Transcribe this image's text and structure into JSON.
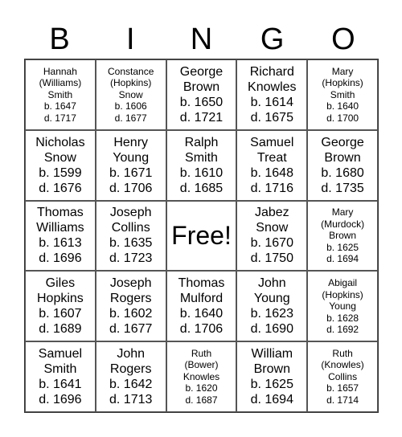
{
  "header": {
    "letters": [
      "B",
      "I",
      "N",
      "G",
      "O"
    ]
  },
  "cells": [
    {
      "text": "Hannah\n(Williams)\nSmith\nb. 1647\nd. 1717",
      "size": "sm"
    },
    {
      "text": "Constance\n(Hopkins)\nSnow\nb. 1606\nd. 1677",
      "size": "sm"
    },
    {
      "text": "George\nBrown\nb. 1650\nd. 1721",
      "size": "lg"
    },
    {
      "text": "Richard\nKnowles\nb. 1614\nd. 1675",
      "size": "lg"
    },
    {
      "text": "Mary\n(Hopkins)\nSmith\nb. 1640\nd. 1700",
      "size": "sm"
    },
    {
      "text": "Nicholas\nSnow\nb. 1599\nd. 1676",
      "size": "lg"
    },
    {
      "text": "Henry\nYoung\nb. 1671\nd. 1706",
      "size": "lg"
    },
    {
      "text": "Ralph\nSmith\nb. 1610\nd. 1685",
      "size": "lg"
    },
    {
      "text": "Samuel\nTreat\nb. 1648\nd. 1716",
      "size": "lg"
    },
    {
      "text": "George\nBrown\nb. 1680\nd. 1735",
      "size": "lg"
    },
    {
      "text": "Thomas\nWilliams\nb. 1613\nd. 1696",
      "size": "lg"
    },
    {
      "text": "Joseph\nCollins\nb. 1635\nd. 1723",
      "size": "lg"
    },
    {
      "text": "Free!",
      "size": "free"
    },
    {
      "text": "Jabez\nSnow\nb. 1670\nd. 1750",
      "size": "lg"
    },
    {
      "text": "Mary\n(Murdock)\nBrown\nb. 1625\nd. 1694",
      "size": "sm"
    },
    {
      "text": "Giles\nHopkins\nb. 1607\nd. 1689",
      "size": "lg"
    },
    {
      "text": "Joseph\nRogers\nb. 1602\nd. 1677",
      "size": "lg"
    },
    {
      "text": "Thomas\nMulford\nb. 1640\nd. 1706",
      "size": "lg"
    },
    {
      "text": "John\nYoung\nb. 1623\nd. 1690",
      "size": "lg"
    },
    {
      "text": "Abigail\n(Hopkins)\nYoung\nb. 1628\nd. 1692",
      "size": "sm"
    },
    {
      "text": "Samuel\nSmith\nb. 1641\nd. 1696",
      "size": "lg"
    },
    {
      "text": "John\nRogers\nb. 1642\nd. 1713",
      "size": "lg"
    },
    {
      "text": "Ruth\n(Bower)\nKnowles\nb. 1620\nd. 1687",
      "size": "sm"
    },
    {
      "text": "William\nBrown\nb. 1625\nd. 1694",
      "size": "lg"
    },
    {
      "text": "Ruth\n(Knowles)\nCollins\nb. 1657\nd. 1714",
      "size": "sm"
    }
  ]
}
